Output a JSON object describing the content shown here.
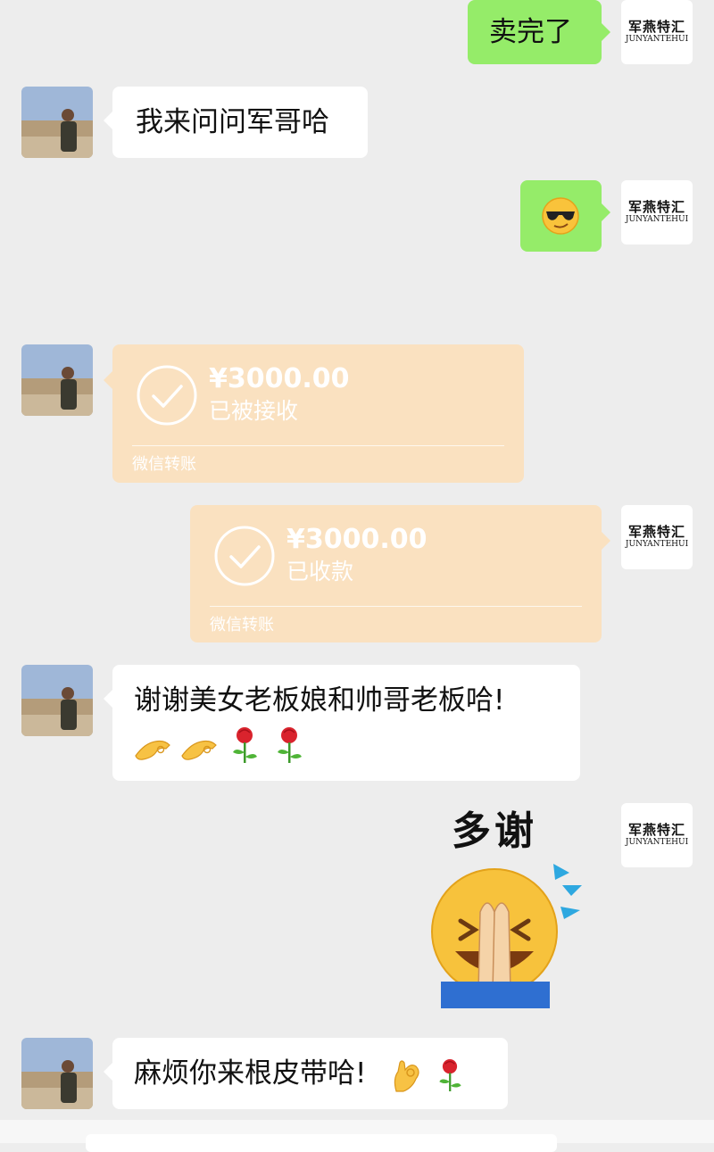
{
  "me": {
    "avatar_cn": "军燕特汇",
    "avatar_en": "JUNYANTEHUI"
  },
  "messages": [
    {
      "from": "me",
      "type": "text",
      "text": "卖完了"
    },
    {
      "from": "other",
      "type": "text",
      "text": "我来问问军哥哈"
    },
    {
      "from": "me",
      "type": "emoji",
      "emoji": "sunglasses-emoji"
    },
    {
      "from": "other",
      "type": "transfer",
      "amount": "¥3000.00",
      "status": "已被接收",
      "footer": "微信转账"
    },
    {
      "from": "me",
      "type": "transfer",
      "amount": "¥3000.00",
      "status": "已收款",
      "footer": "微信转账"
    },
    {
      "from": "other",
      "type": "text",
      "line1": "谢谢美女老板娘和帅哥老板哈!",
      "emojis": [
        "ok-hand-emoji",
        "ok-hand-emoji",
        "rose-emoji",
        "rose-emoji"
      ]
    },
    {
      "from": "me",
      "type": "sticker",
      "caption": "多谢",
      "sticker": "grateful-praying-face-sticker"
    },
    {
      "from": "other",
      "type": "text",
      "text": "麻烦你来根皮带哈!",
      "emojis": [
        "ok-hand-emoji",
        "rose-emoji"
      ]
    }
  ],
  "colors": {
    "background": "#ededed",
    "sent_bubble": "#95ec69",
    "received_bubble": "#ffffff",
    "transfer": "#fae1c0"
  }
}
